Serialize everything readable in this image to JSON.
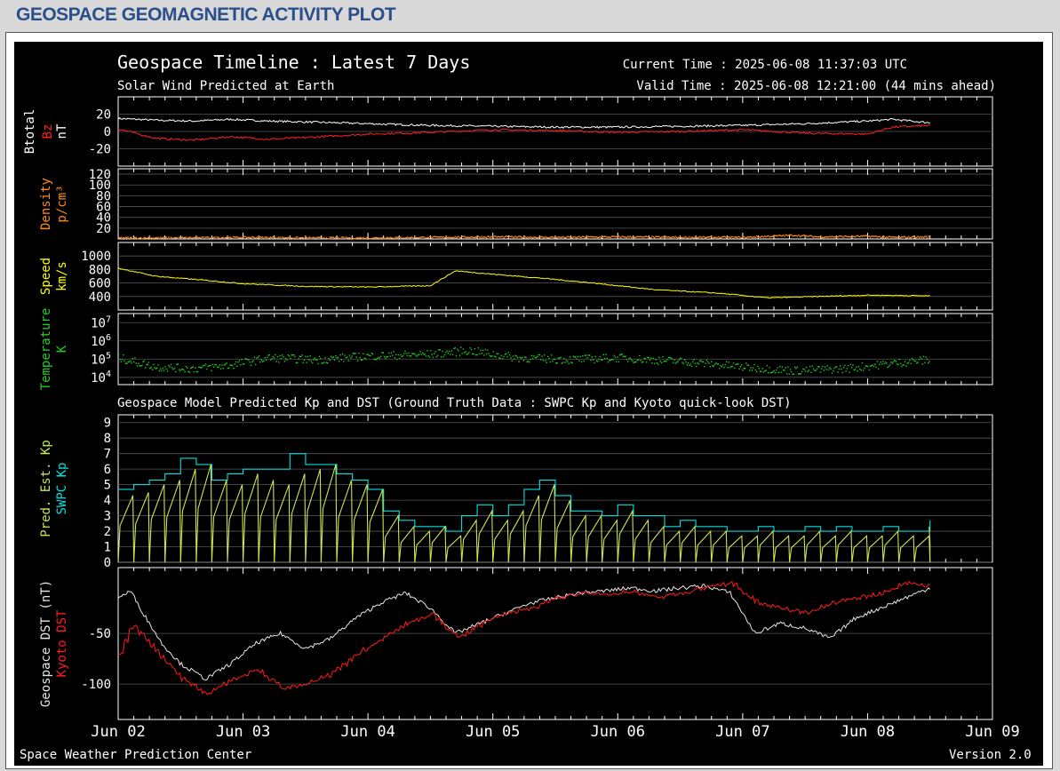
{
  "page": {
    "header_title": "GEOSPACE GEOMAGNETIC ACTIVITY PLOT",
    "footer_left": "Space Weather Prediction Center",
    "footer_right": "Version 2.0"
  },
  "chart_data": {
    "type": "line",
    "title": "Geospace Timeline : Latest 7 Days",
    "subtitle": "Solar Wind Predicted at Earth",
    "current_time": "Current Time : 2025-06-08 11:37:03 UTC",
    "valid_time": "Valid Time : 2025-06-08 12:21:00 (44 mins ahead)",
    "section2_title": "Geospace Model Predicted Kp and DST (Ground Truth Data : SWPC Kp and Kyoto quick-look DST)",
    "x_ticks": [
      "Jun 02",
      "Jun 03",
      "Jun 04",
      "Jun 05",
      "Jun 06",
      "Jun 07",
      "Jun 08",
      "Jun 09"
    ],
    "xlim_days": [
      0,
      7
    ],
    "data_end_day": 6.5,
    "colors": {
      "btotal": "#ffffff",
      "bz": "#ff2020",
      "density": "#ff8c1a",
      "speed": "#ffff00",
      "temperature": "#22cc22",
      "pred_kp": "#c8e650",
      "swpc_kp": "#00e0e0",
      "geospace_dst": "#e6e6e6",
      "kyoto_dst": "#ff1a1a",
      "grid": "#555555",
      "text": "#ffffff"
    },
    "panels": [
      {
        "id": "mag",
        "ylabels": [
          {
            "text": "Btotal",
            "color": "#ffffff"
          },
          {
            "text": "Bz",
            "color": "#ff2020"
          },
          {
            "text": "nT",
            "color": "#ffffff"
          }
        ],
        "yticks": [
          20,
          0,
          -20
        ],
        "ylim": [
          -40,
          40
        ],
        "series": [
          {
            "key": "btotal",
            "name": "Btotal",
            "color": "#ffffff",
            "x": [
              0,
              0.3,
              0.6,
              0.9,
              1.2,
              1.5,
              2.0,
              2.5,
              3.0,
              3.5,
              4.0,
              4.5,
              5.0,
              5.5,
              6.0,
              6.2,
              6.5
            ],
            "y": [
              15,
              13,
              12,
              14,
              12,
              11,
              9,
              7,
              6,
              5,
              5,
              6,
              7,
              9,
              12,
              14,
              10
            ]
          },
          {
            "key": "bz",
            "name": "Bz",
            "color": "#ff2020",
            "x": [
              0,
              0.3,
              0.6,
              0.9,
              1.2,
              1.5,
              2.0,
              2.5,
              3.0,
              3.5,
              4.0,
              4.5,
              5.0,
              5.5,
              6.0,
              6.2,
              6.5
            ],
            "y": [
              3,
              -8,
              -10,
              -6,
              -9,
              -7,
              -3,
              -1,
              2,
              1,
              -1,
              0,
              2,
              -2,
              -3,
              5,
              7
            ]
          }
        ]
      },
      {
        "id": "density",
        "ylabels": [
          {
            "text": "Density",
            "color": "#ff8c1a"
          },
          {
            "text": "p/cm³",
            "color": "#ff8c1a"
          }
        ],
        "yticks": [
          120,
          100,
          80,
          60,
          40,
          20
        ],
        "ylim": [
          0,
          130
        ],
        "series": [
          {
            "key": "density",
            "name": "Density",
            "color": "#ff8c1a",
            "x": [
              0,
              0.5,
              1.0,
              1.5,
              2.0,
              2.5,
              3.0,
              3.5,
              4.0,
              4.5,
              5.0,
              5.2,
              5.4,
              5.6,
              6.0,
              6.2,
              6.5
            ],
            "y": [
              3,
              3,
              4,
              3,
              3,
              4,
              5,
              4,
              5,
              4,
              4,
              6,
              8,
              5,
              6,
              4,
              5
            ]
          }
        ]
      },
      {
        "id": "speed",
        "ylabels": [
          {
            "text": "Speed",
            "color": "#ffff00"
          },
          {
            "text": "km/s",
            "color": "#ffff00"
          }
        ],
        "yticks": [
          1000,
          800,
          600,
          400
        ],
        "ylim": [
          200,
          1200
        ],
        "series": [
          {
            "key": "speed",
            "name": "Speed",
            "color": "#ffff00",
            "x": [
              0,
              0.3,
              0.7,
              1.0,
              1.5,
              2.0,
              2.5,
              2.7,
              3.0,
              3.4,
              3.8,
              4.3,
              4.8,
              5.2,
              5.6,
              6.0,
              6.5
            ],
            "y": [
              820,
              700,
              640,
              590,
              550,
              540,
              560,
              780,
              730,
              670,
              600,
              500,
              450,
              380,
              400,
              420,
              410
            ]
          }
        ]
      },
      {
        "id": "temperature",
        "ylabels": [
          {
            "text": "Temperature",
            "color": "#22cc22"
          },
          {
            "text": "K",
            "color": "#22cc22"
          }
        ],
        "yticks_log": [
          7,
          6,
          5,
          4
        ],
        "ylim_log": [
          3.6,
          7.5
        ],
        "series": [
          {
            "key": "temperature",
            "name": "Temperature",
            "color": "#22cc22",
            "x": [
              0,
              0.3,
              0.6,
              0.9,
              1.2,
              1.6,
              2.0,
              2.5,
              2.8,
              3.2,
              3.6,
              4.0,
              4.5,
              5.0,
              5.4,
              5.8,
              6.2,
              6.5
            ],
            "log_y": [
              5.1,
              4.6,
              4.5,
              4.7,
              5.1,
              5.0,
              5.2,
              5.3,
              5.5,
              5.1,
              5.0,
              5.1,
              4.9,
              4.6,
              4.4,
              4.5,
              4.8,
              5.0
            ]
          }
        ]
      },
      {
        "id": "kp",
        "ylabels": [
          {
            "text": "Pred. Est. Kp",
            "color": "#c8e650"
          },
          {
            "text": "SWPC Kp",
            "color": "#00e0e0"
          }
        ],
        "yticks": [
          9,
          8,
          7,
          6,
          5,
          4,
          3,
          2,
          1,
          0
        ],
        "ylim": [
          0,
          9.5
        ],
        "series": [
          {
            "key": "swpc_kp",
            "name": "SWPC Kp",
            "color": "#00e0e0",
            "step_hours": 3,
            "values": [
              4.7,
              5,
              5.3,
              5.7,
              6.7,
              6.3,
              5.3,
              5.7,
              6.0,
              6.0,
              6.0,
              7.0,
              6.3,
              6.3,
              5.7,
              5.3,
              4.7,
              3.3,
              2.7,
              2.3,
              2.3,
              2.0,
              3.0,
              3.7,
              3.0,
              3.7,
              4.7,
              5.3,
              4.3,
              3.3,
              3.3,
              3.0,
              3.7,
              3.0,
              3.0,
              2.3,
              2.7,
              2.3,
              2.3,
              2.0,
              2.0,
              2.3,
              2.0,
              2.0,
              2.3,
              2.0,
              2.3,
              2.0,
              2.0,
              2.3,
              2.0,
              2.0,
              2.7,
              3.0,
              4.3,
              4.7,
              2.0,
              2.3,
              4.7,
              4.3,
              2.7,
              2.3,
              2.0,
              2.0,
              1.7,
              1.7,
              2.0,
              2.0,
              2.0,
              2.0,
              2.0,
              2.0
            ]
          },
          {
            "key": "pred_kp",
            "name": "Pred. Est. Kp",
            "color": "#c8e650",
            "step_hours": 3,
            "values": [
              4.3,
              4.5,
              5.0,
              5.3,
              6.0,
              6.3,
              5.3,
              5.0,
              5.7,
              5.3,
              5.0,
              5.7,
              6.0,
              6.3,
              5.3,
              5.0,
              4.7,
              3.0,
              2.3,
              2.0,
              2.3,
              1.7,
              2.7,
              3.3,
              2.7,
              3.3,
              4.3,
              5.0,
              4.0,
              3.0,
              3.0,
              2.7,
              3.3,
              2.7,
              2.3,
              2.0,
              2.3,
              2.0,
              2.0,
              1.7,
              1.7,
              2.0,
              1.7,
              1.7,
              2.0,
              1.7,
              2.0,
              1.7,
              1.7,
              2.0,
              1.7,
              1.7,
              2.3,
              2.7,
              4.0,
              4.3,
              1.7,
              2.0,
              4.3,
              4.0,
              2.3,
              2.0,
              1.7,
              1.7,
              1.7,
              1.7,
              2.0,
              1.7,
              1.7,
              1.7,
              1.7,
              2.3
            ]
          }
        ]
      },
      {
        "id": "dst",
        "ylabels": [
          {
            "text": "Geospace DST (nT)",
            "color": "#e6e6e6"
          },
          {
            "text": "Kyoto DST",
            "color": "#ff1a1a"
          }
        ],
        "yticks": [
          -50,
          -100
        ],
        "ylim": [
          -135,
          15
        ],
        "series": [
          {
            "key": "geospace_dst",
            "name": "Geospace DST",
            "color": "#e6e6e6",
            "x": [
              0,
              0.1,
              0.2,
              0.35,
              0.5,
              0.7,
              0.9,
              1.1,
              1.3,
              1.5,
              1.7,
              1.9,
              2.1,
              2.3,
              2.5,
              2.7,
              2.9,
              3.1,
              3.3,
              3.5,
              3.7,
              3.9,
              4.1,
              4.3,
              4.5,
              4.7,
              4.9,
              5.1,
              5.3,
              5.5,
              5.7,
              5.9,
              6.1,
              6.3,
              6.5
            ],
            "y": [
              -15,
              -8,
              -30,
              -60,
              -80,
              -95,
              -80,
              -60,
              -50,
              -65,
              -55,
              -35,
              -20,
              -10,
              -25,
              -50,
              -40,
              -30,
              -20,
              -15,
              -10,
              -8,
              -5,
              -8,
              -5,
              -3,
              -10,
              -50,
              -40,
              -45,
              -55,
              -35,
              -25,
              -15,
              -5
            ]
          },
          {
            "key": "kyoto_dst",
            "name": "Kyoto DST",
            "color": "#ff1a1a",
            "x": [
              0,
              0.1,
              0.2,
              0.35,
              0.5,
              0.7,
              0.9,
              1.1,
              1.3,
              1.5,
              1.7,
              1.9,
              2.1,
              2.3,
              2.5,
              2.7,
              2.9,
              3.1,
              3.3,
              3.5,
              3.7,
              3.9,
              4.1,
              4.3,
              4.5,
              4.7,
              4.9,
              5.1,
              5.3,
              5.5,
              5.7,
              5.9,
              6.1,
              6.3,
              6.5
            ],
            "y": [
              -70,
              -40,
              -55,
              -75,
              -95,
              -110,
              -95,
              -85,
              -105,
              -100,
              -90,
              -70,
              -55,
              -40,
              -30,
              -55,
              -40,
              -30,
              -25,
              -15,
              -10,
              -12,
              -8,
              -15,
              -10,
              -5,
              0,
              -20,
              -25,
              -30,
              -20,
              -15,
              -10,
              0,
              -3
            ]
          }
        ]
      }
    ]
  }
}
